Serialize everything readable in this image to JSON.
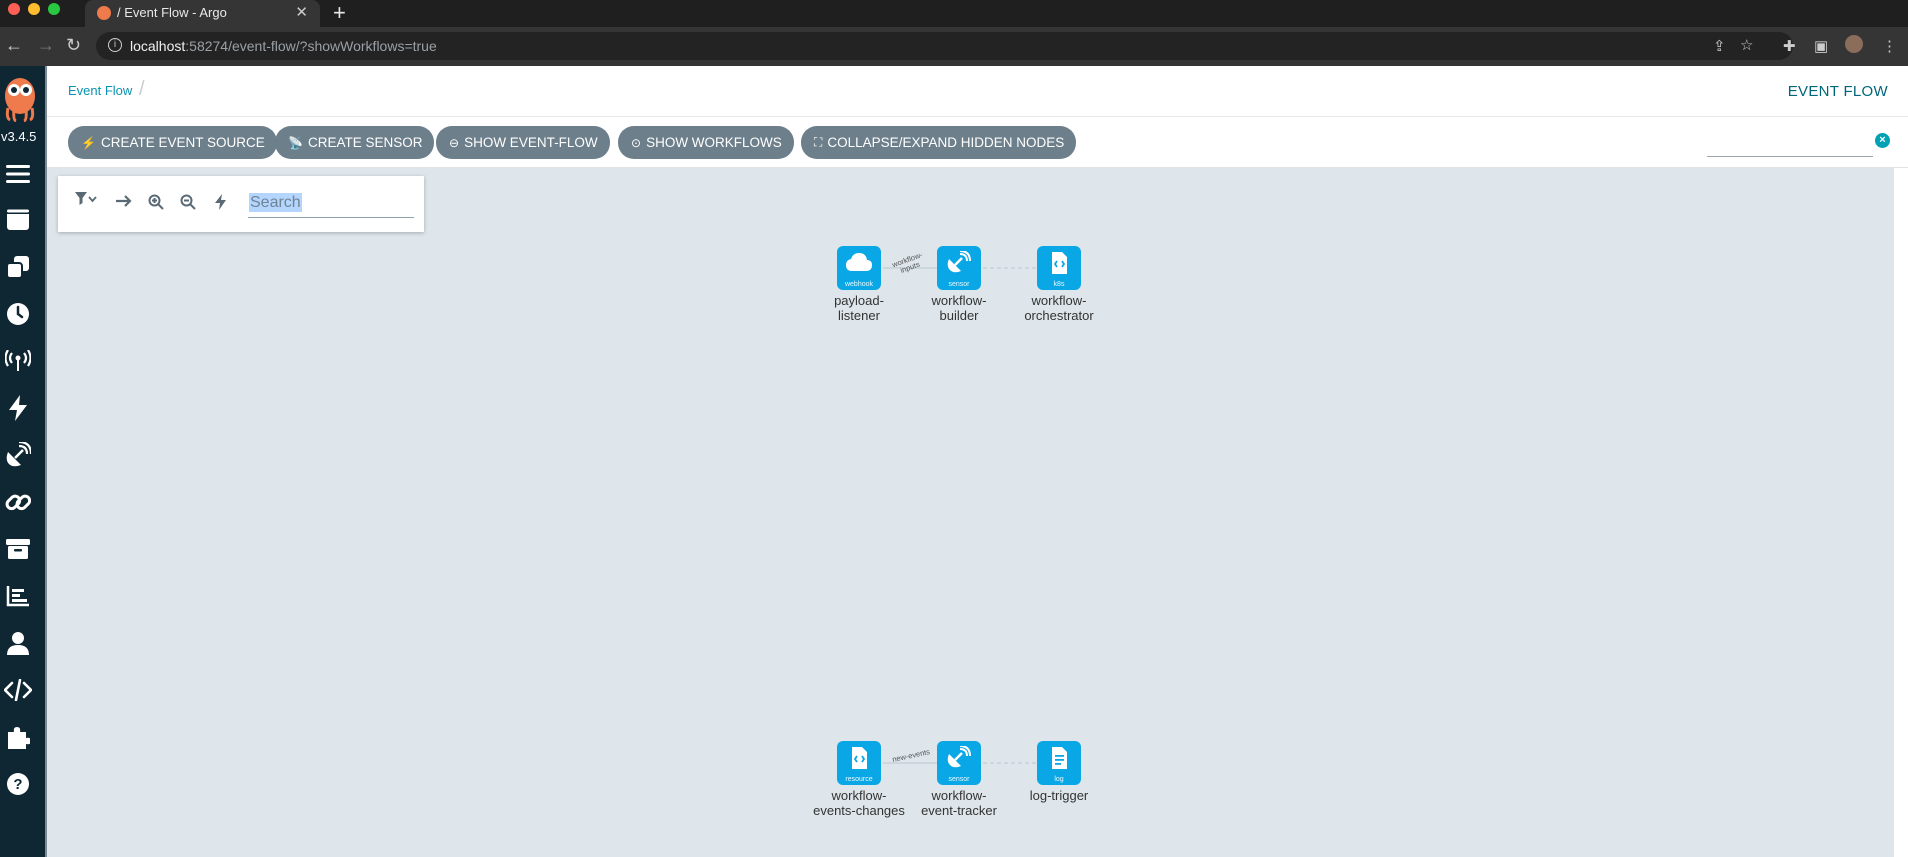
{
  "browser": {
    "tab_title": "/ Event Flow - Argo",
    "url_host": "localhost",
    "url_path": ":58274/event-flow/?showWorkflows=true"
  },
  "sidebar": {
    "version": "v3.4.5",
    "items": [
      {
        "icon": "menu-icon"
      },
      {
        "icon": "workflows-icon"
      },
      {
        "icon": "workflow-templates-icon"
      },
      {
        "icon": "cron-workflows-icon"
      },
      {
        "icon": "event-sources-icon"
      },
      {
        "icon": "event-flow-icon"
      },
      {
        "icon": "sensors-icon"
      },
      {
        "icon": "link-icon"
      },
      {
        "icon": "archive-icon"
      },
      {
        "icon": "reports-icon"
      },
      {
        "icon": "user-icon"
      },
      {
        "icon": "api-docs-icon"
      },
      {
        "icon": "plugins-icon"
      },
      {
        "icon": "help-icon"
      }
    ]
  },
  "header": {
    "breadcrumb": "Event Flow",
    "title": "EVENT FLOW"
  },
  "toolbar": {
    "buttons": [
      {
        "label": "CREATE EVENT SOURCE",
        "icon": "bolt-icon"
      },
      {
        "label": "CREATE SENSOR",
        "icon": "sensor-icon"
      },
      {
        "label": "SHOW EVENT-FLOW",
        "icon": "toggle-off-icon"
      },
      {
        "label": "SHOW WORKFLOWS",
        "icon": "toggle-on-icon"
      },
      {
        "label": "COLLAPSE/EXPAND HIDDEN NODES",
        "icon": "expand-icon"
      }
    ]
  },
  "graph_panel": {
    "search_placeholder": "Search"
  },
  "graph": {
    "groups": [
      {
        "nodes": [
          {
            "type": "webhook",
            "label_l1": "payload-",
            "label_l2": "listener",
            "icon": "cloud-icon"
          },
          {
            "type": "sensor",
            "label_l1": "workflow-",
            "label_l2": "builder",
            "icon": "satellite-dish-icon"
          },
          {
            "type": "k8s",
            "label_l1": "workflow-",
            "label_l2": "orchestrator",
            "icon": "file-code-icon"
          }
        ],
        "edge_label_l1": "workflow-",
        "edge_label_l2": "inputs"
      },
      {
        "nodes": [
          {
            "type": "resource",
            "label_l1": "workflow-",
            "label_l2": "events-changes",
            "icon": "file-code-icon"
          },
          {
            "type": "sensor",
            "label_l1": "workflow-",
            "label_l2": "event-tracker",
            "icon": "satellite-dish-icon"
          },
          {
            "type": "log",
            "label_l1": "log-trigger",
            "label_l2": "",
            "icon": "file-text-icon"
          }
        ],
        "edge_label_l1": "new-events",
        "edge_label_l2": ""
      }
    ]
  },
  "colors": {
    "node": "#0aa7e6",
    "sidebar": "#0f2733",
    "button": "#6d7f8b",
    "accent": "#0a93b1",
    "canvas": "#dee6eb"
  }
}
